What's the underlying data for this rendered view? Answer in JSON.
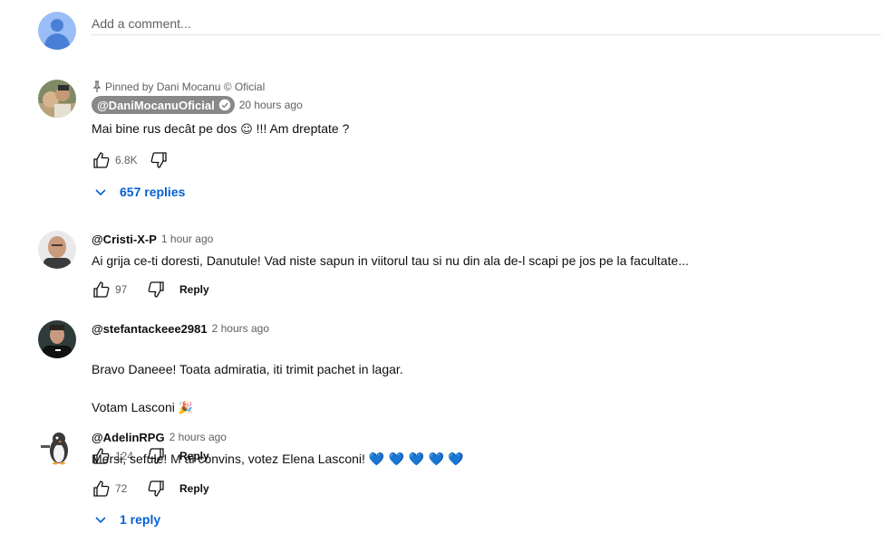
{
  "add_comment": {
    "placeholder": "Add a comment..."
  },
  "comments": [
    {
      "pinned_text": "Pinned by Dani Mocanu © Oficial",
      "author": "@DaniMocanuOficial",
      "verified": true,
      "time": "20 hours ago",
      "text_before_emoji": "Mai bine rus decât pe dos ",
      "emoji": "☺",
      "text_after_emoji": " !!! Am dreptate ?",
      "likes": "6.8K",
      "replies_label": "657 replies"
    },
    {
      "author": "@Cristi-X-P",
      "time": "1 hour ago",
      "text": "Ai grija ce-ti doresti, Danutule! Vad niste sapun in viitorul tau si nu din ala de-l scapi pe jos pe la facultate...",
      "likes": "97",
      "reply_label": "Reply"
    },
    {
      "author": "@stefantackeee2981",
      "time": "2 hours ago",
      "text_line1": "Bravo Daneee! Toata admiratia, iti trimit pachet in lagar.",
      "text_line2": "Votam Lasconi ",
      "emoji": "🎉",
      "likes": "124",
      "reply_label": "Reply"
    },
    {
      "author": "@AdelinRPG",
      "time": "2 hours ago",
      "text": "Mersi, sefule! M ai convins, votez Elena Lasconi! ",
      "hearts": "💙 💙 💙 💙 💙",
      "likes": "72",
      "reply_label": "Reply",
      "replies_label": "1 reply"
    }
  ],
  "colors": {
    "link_blue": "#065fd4",
    "secondary_text": "#606060",
    "divider": "#e5e5e5",
    "chip_gray": "#888888",
    "heart_blue": "#2f88e8"
  },
  "icons": {
    "like": "thumbs-up-icon",
    "dislike": "thumbs-down-icon",
    "pin": "pin-icon",
    "verified": "verified-check-icon",
    "expand": "chevron-down-icon"
  }
}
